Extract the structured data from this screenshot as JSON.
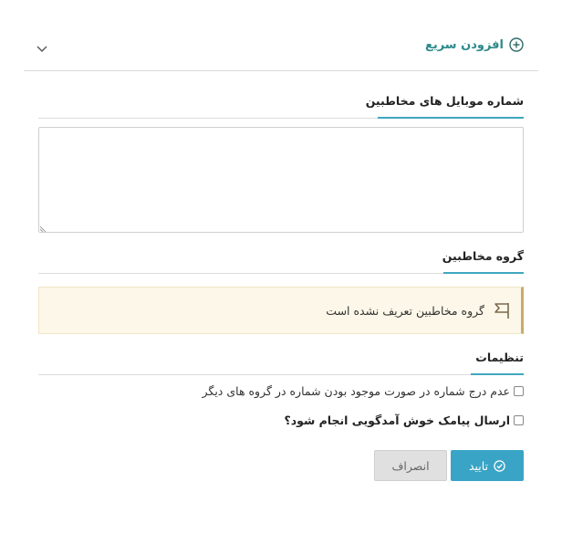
{
  "quick_add": {
    "title": "افزودن سریع",
    "icons": {
      "add": "plus-circle-icon",
      "toggle": "chevron-down-icon"
    }
  },
  "mobile_numbers": {
    "title": "شماره موبایل های مخاطبین",
    "value": ""
  },
  "contact_group": {
    "title": "گروه مخاطبین",
    "alert_text": "گروه مخاطبین تعریف نشده است",
    "alert_icon": "flag-icon"
  },
  "settings": {
    "title": "تنظیمات",
    "options": [
      {
        "label": "عدم درج شماره در صورت موجود بودن شماره در گروه های دیگر",
        "checked": false
      },
      {
        "label": "ارسال پیامک خوش آمدگویی انجام شود؟",
        "checked": false
      }
    ]
  },
  "actions": {
    "confirm_label": "تایید",
    "cancel_label": "انصراف"
  },
  "colors": {
    "accent": "#3fa7bf",
    "title_teal": "#2e8a8a",
    "confirm_bg": "#3aa4c6",
    "alert_bg": "#fcf7e8",
    "alert_border": "#c9ab6c"
  }
}
